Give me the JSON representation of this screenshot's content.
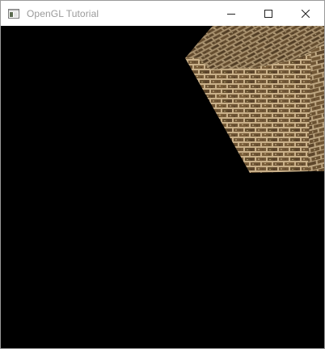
{
  "window": {
    "title": "OpenGL Tutorial",
    "icons": {
      "app": "application-icon",
      "minimize": "minimize-icon",
      "maximize": "maximize-icon",
      "close": "close-icon"
    }
  },
  "scene": {
    "background": "#000000",
    "object": "textured-cube",
    "texture": "brick-wall",
    "colors": {
      "mortar": "#c9b089",
      "brick": "#6e5434",
      "highlight": "#e3cfa4",
      "shadow": "#2d2216"
    }
  }
}
